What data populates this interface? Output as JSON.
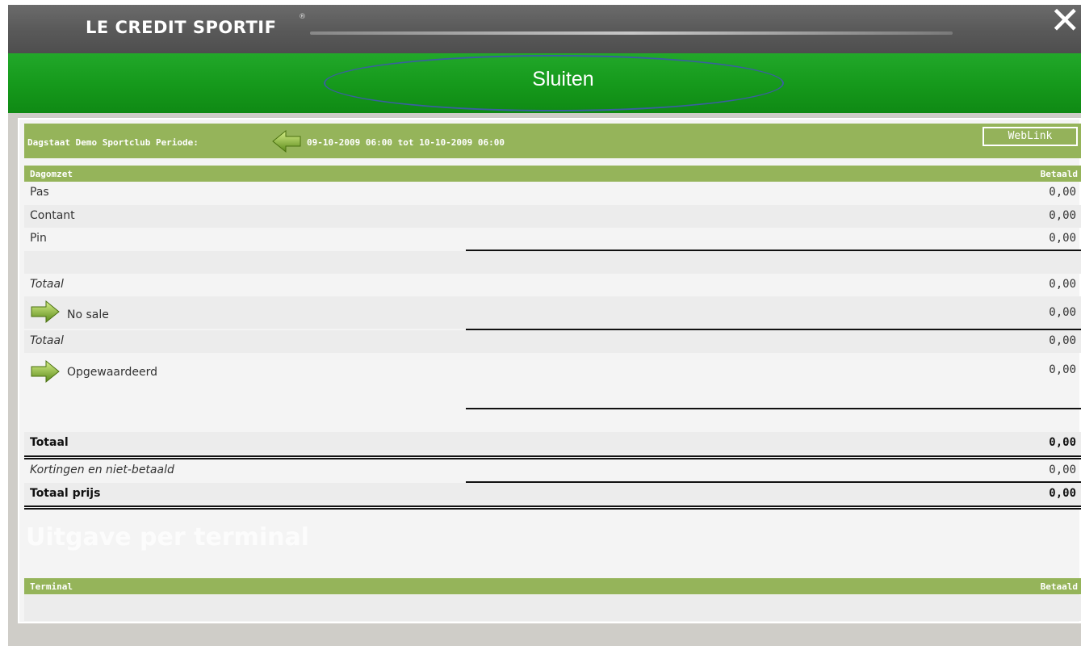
{
  "window": {
    "brand": "LE CREDIT SPORTIF",
    "brand_mark": "®",
    "close_icon": "close-icon"
  },
  "banner": {
    "label": "Sluiten"
  },
  "report": {
    "title": "Dagstaat Demo Sportclub Periode:",
    "period": "09-10-2009 06:00 tot 10-10-2009 06:00",
    "weblink": "WebLink"
  },
  "dagomzet": {
    "header_left": "Dagomzet",
    "header_right": "Betaald",
    "rows": [
      {
        "label": "Pas",
        "value": "0,00"
      },
      {
        "label": "Contant",
        "value": "0,00"
      },
      {
        "label": "Pin",
        "value": "0,00"
      }
    ],
    "subtotal1": {
      "label": "Totaal",
      "value": "0,00"
    },
    "no_sale": {
      "label": "No sale",
      "value": "0,00"
    },
    "subtotal2": {
      "label": "Totaal",
      "value": "0,00"
    },
    "opgewaardeerd": {
      "label": "Opgewaardeerd",
      "value": "0,00"
    },
    "total": {
      "label": "Totaal",
      "value": "0,00"
    },
    "discounts": {
      "label": "Kortingen en niet-betaald",
      "value": "0,00"
    },
    "total_price": {
      "label": "Totaal prijs",
      "value": "0,00"
    }
  },
  "terminal": {
    "section_title": "Uitgave per terminal",
    "header_left": "Terminal",
    "header_right": "Betaald"
  },
  "colors": {
    "titlebar": "#5a5a5a",
    "banner": "#169a1c",
    "section_header": "#95b45a",
    "ellipse": "#3a5fa0"
  }
}
